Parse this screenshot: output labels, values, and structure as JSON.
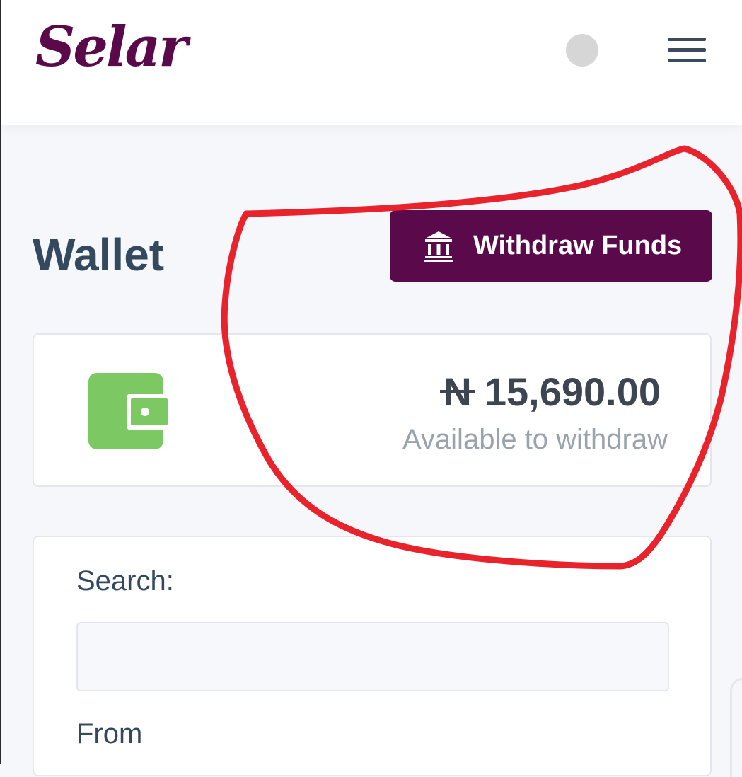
{
  "header": {
    "logo_text": "Selar",
    "avatar_icon": "user-avatar",
    "menu_icon": "hamburger-menu-icon"
  },
  "wallet": {
    "title": "Wallet",
    "withdraw_button": {
      "label": "Withdraw Funds",
      "icon": "bank-icon"
    },
    "balance": {
      "currency_symbol": "N",
      "amount": "15,690.00",
      "caption": "Available to withdraw"
    }
  },
  "filters": {
    "search_label": "Search:",
    "search_placeholder": "",
    "from_label": "From"
  },
  "colors": {
    "brand": "#5a0a4a",
    "wallet_icon": "#7cc963",
    "annotation": "#e8232b"
  }
}
